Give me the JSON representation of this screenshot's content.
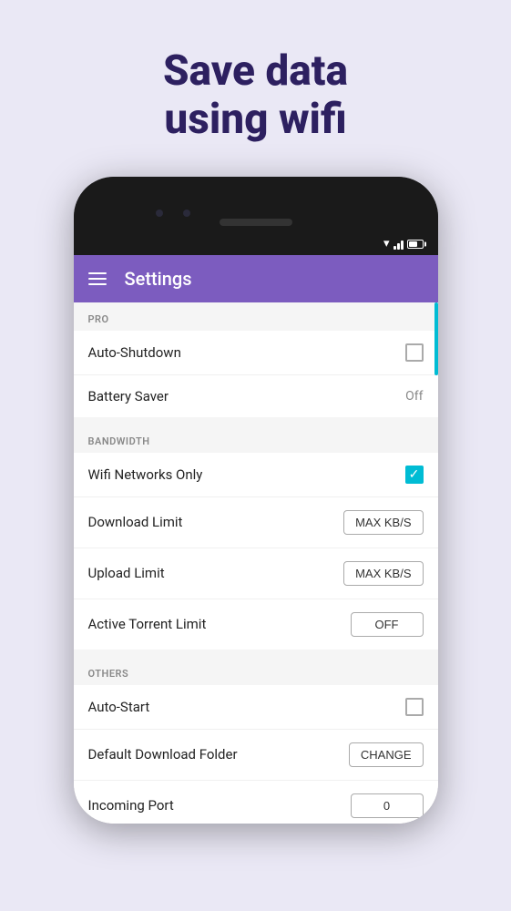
{
  "hero": {
    "title_line1": "Save data",
    "title_line2": "using wifi"
  },
  "phone": {
    "status": {
      "wifi": "▼",
      "signal": "signal",
      "battery": "battery"
    },
    "appbar": {
      "title": "Settings"
    },
    "sections": [
      {
        "id": "pro",
        "header": "PRO",
        "rows": [
          {
            "label": "Auto-Shutdown",
            "control": "checkbox-unchecked",
            "value": ""
          },
          {
            "label": "Battery Saver",
            "control": "value-text",
            "value": "Off"
          }
        ]
      },
      {
        "id": "bandwidth",
        "header": "BANDWIDTH",
        "rows": [
          {
            "label": "Wifi Networks Only",
            "control": "checkbox-checked",
            "value": ""
          },
          {
            "label": "Download Limit",
            "control": "button",
            "value": "MAX KB/S"
          },
          {
            "label": "Upload Limit",
            "control": "button",
            "value": "MAX KB/S"
          },
          {
            "label": "Active Torrent Limit",
            "control": "button",
            "value": "OFF"
          }
        ]
      },
      {
        "id": "others",
        "header": "OTHERS",
        "rows": [
          {
            "label": "Auto-Start",
            "control": "checkbox-unchecked",
            "value": ""
          },
          {
            "label": "Default Download Folder",
            "control": "button",
            "value": "CHANGE"
          },
          {
            "label": "Incoming Port",
            "control": "button",
            "value": "0"
          }
        ]
      }
    ]
  }
}
